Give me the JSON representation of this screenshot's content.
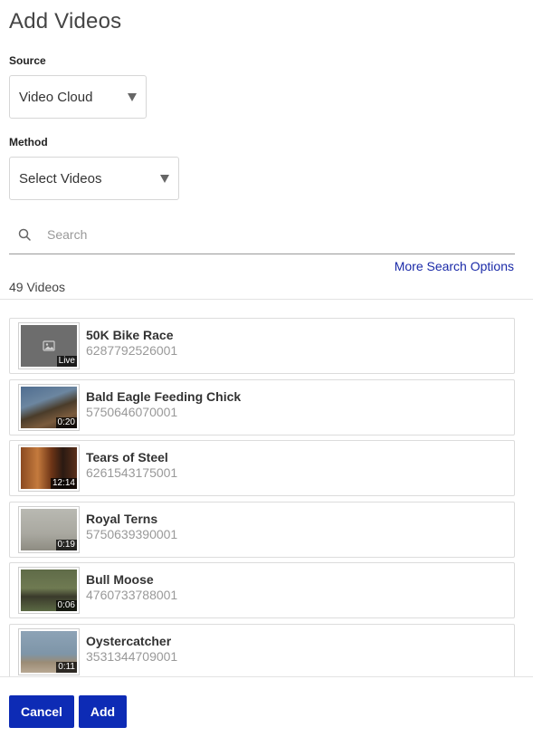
{
  "page": {
    "title": "Add Videos"
  },
  "source": {
    "label": "Source",
    "value": "Video Cloud"
  },
  "method": {
    "label": "Method",
    "value": "Select Videos"
  },
  "search": {
    "placeholder": "Search",
    "more_options": "More Search Options"
  },
  "results": {
    "count_text": "49 Videos"
  },
  "videos": [
    {
      "name": "50K Bike Race",
      "id": "6287792526001",
      "duration": "Live",
      "thumbnail": "placeholder-image-icon"
    },
    {
      "name": "Bald Eagle Feeding Chick",
      "id": "5750646070001",
      "duration": "0:20",
      "thumbnail": "eagle"
    },
    {
      "name": "Tears of Steel",
      "id": "6261543175001",
      "duration": "12:14",
      "thumbnail": "tears"
    },
    {
      "name": "Royal Terns",
      "id": "5750639390001",
      "duration": "0:19",
      "thumbnail": "terns"
    },
    {
      "name": "Bull Moose",
      "id": "4760733788001",
      "duration": "0:06",
      "thumbnail": "moose"
    },
    {
      "name": "Oystercatcher",
      "id": "3531344709001",
      "duration": "0:11",
      "thumbnail": "oystercatcher"
    }
  ],
  "footer": {
    "cancel_label": "Cancel",
    "add_label": "Add"
  },
  "colors": {
    "primary_button": "#0d2bb5",
    "link": "#1a2aa8"
  }
}
